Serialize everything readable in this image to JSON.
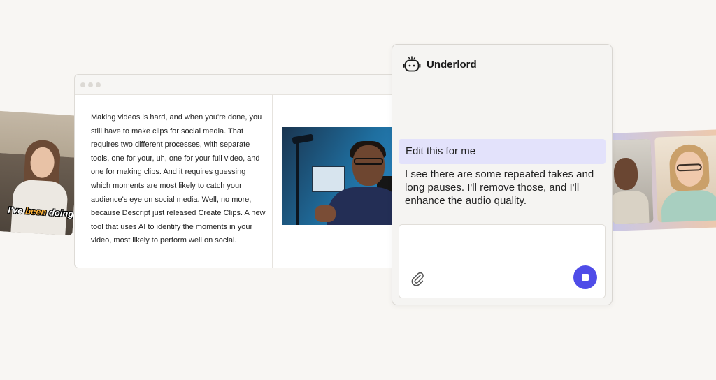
{
  "left_clip": {
    "caption_prefix": "I've ",
    "caption_highlight": "been",
    "caption_suffix": " doing"
  },
  "editor": {
    "transcript": "Making videos is hard, and when you're done, you still have to make clips for social media. That requires two different processes, with separate tools, one for your, uh, one for your full video, and one for making clips. And it requires guessing which moments are most likely to catch your audience's eye on social media. Well, no more, because Descript just released Create Clips. A new tool that uses AI to identify the moments in your video, most likely to perform well on social."
  },
  "panel": {
    "title": "Underlord",
    "icon": "robot-icon",
    "user_message": "Edit this for me",
    "assistant_message": "I see there are some repeated takes and long pauses. I'll remove those, and I'll enhance the audio quality.",
    "attach_icon": "paperclip-icon",
    "stop_icon": "stop-icon"
  },
  "colors": {
    "background": "#f8f6f3",
    "accent": "#4f4ce8",
    "user_bubble": "#e3e2fb"
  }
}
